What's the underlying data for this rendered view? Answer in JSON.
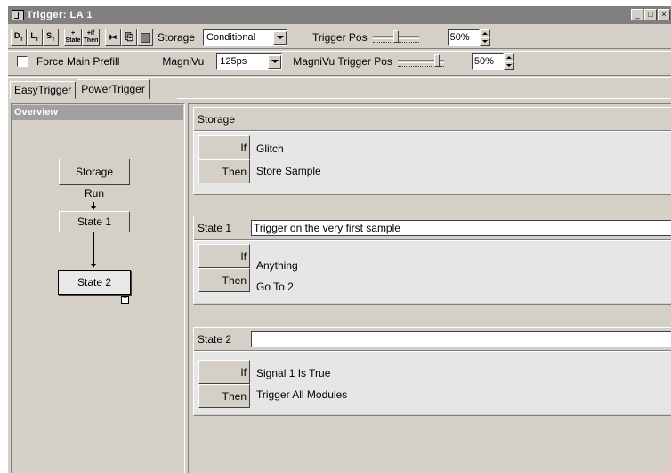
{
  "window": {
    "title": "Trigger: LA 1",
    "controls": [
      "_",
      "□",
      "×"
    ]
  },
  "toolbar": {
    "icon_buttons": [
      {
        "name": "d-trigger-button",
        "label": "D",
        "sub": "T"
      },
      {
        "name": "l-trigger-button",
        "label": "L",
        "sub": "T"
      },
      {
        "name": "s-trigger-button",
        "label": "S",
        "sub": "T"
      },
      {
        "name": "add-state-button",
        "label": "+ State"
      },
      {
        "name": "add-if-then-button",
        "label": "+If Then"
      },
      {
        "name": "cut-button",
        "label": "✂"
      },
      {
        "name": "copy-button",
        "label": "⎘"
      },
      {
        "name": "paste-button",
        "label": "📋"
      }
    ],
    "storage_label": "Storage",
    "storage_value": "Conditional",
    "trigger_pos_label": "Trigger Pos",
    "trigger_pos_value": "50%",
    "trigger_pos_fraction": 0.5,
    "force_prefill_label": "Force Main Prefill",
    "force_prefill_checked": false,
    "magnivu_label": "MagniVu",
    "magnivu_value": "125ps",
    "magnivu_pos_label": "MagniVu Trigger Pos",
    "magnivu_pos_value": "50%",
    "magnivu_pos_fraction": 0.9
  },
  "tabs": [
    {
      "label": "EasyTrigger",
      "active": false
    },
    {
      "label": "PowerTrigger",
      "active": true
    }
  ],
  "overview": {
    "title": "Overview",
    "nodes": [
      {
        "label": "Storage"
      },
      {
        "label": "State 1"
      },
      {
        "label": "State 2",
        "badge": "T"
      }
    ],
    "run_label": "Run"
  },
  "blocks": [
    {
      "name": "Storage",
      "description": null,
      "if_label": "If",
      "then_label": "Then",
      "condition": "Glitch",
      "action": "Store Sample"
    },
    {
      "name": "State 1",
      "description": "Trigger on the very first sample",
      "if_label": "If",
      "then_label": "Then",
      "condition": "Anything",
      "action": "Go To 2"
    },
    {
      "name": "State 2",
      "description": "",
      "if_label": "If",
      "then_label": "Then",
      "condition": "Signal 1 Is True",
      "action": "Trigger All Modules"
    }
  ]
}
